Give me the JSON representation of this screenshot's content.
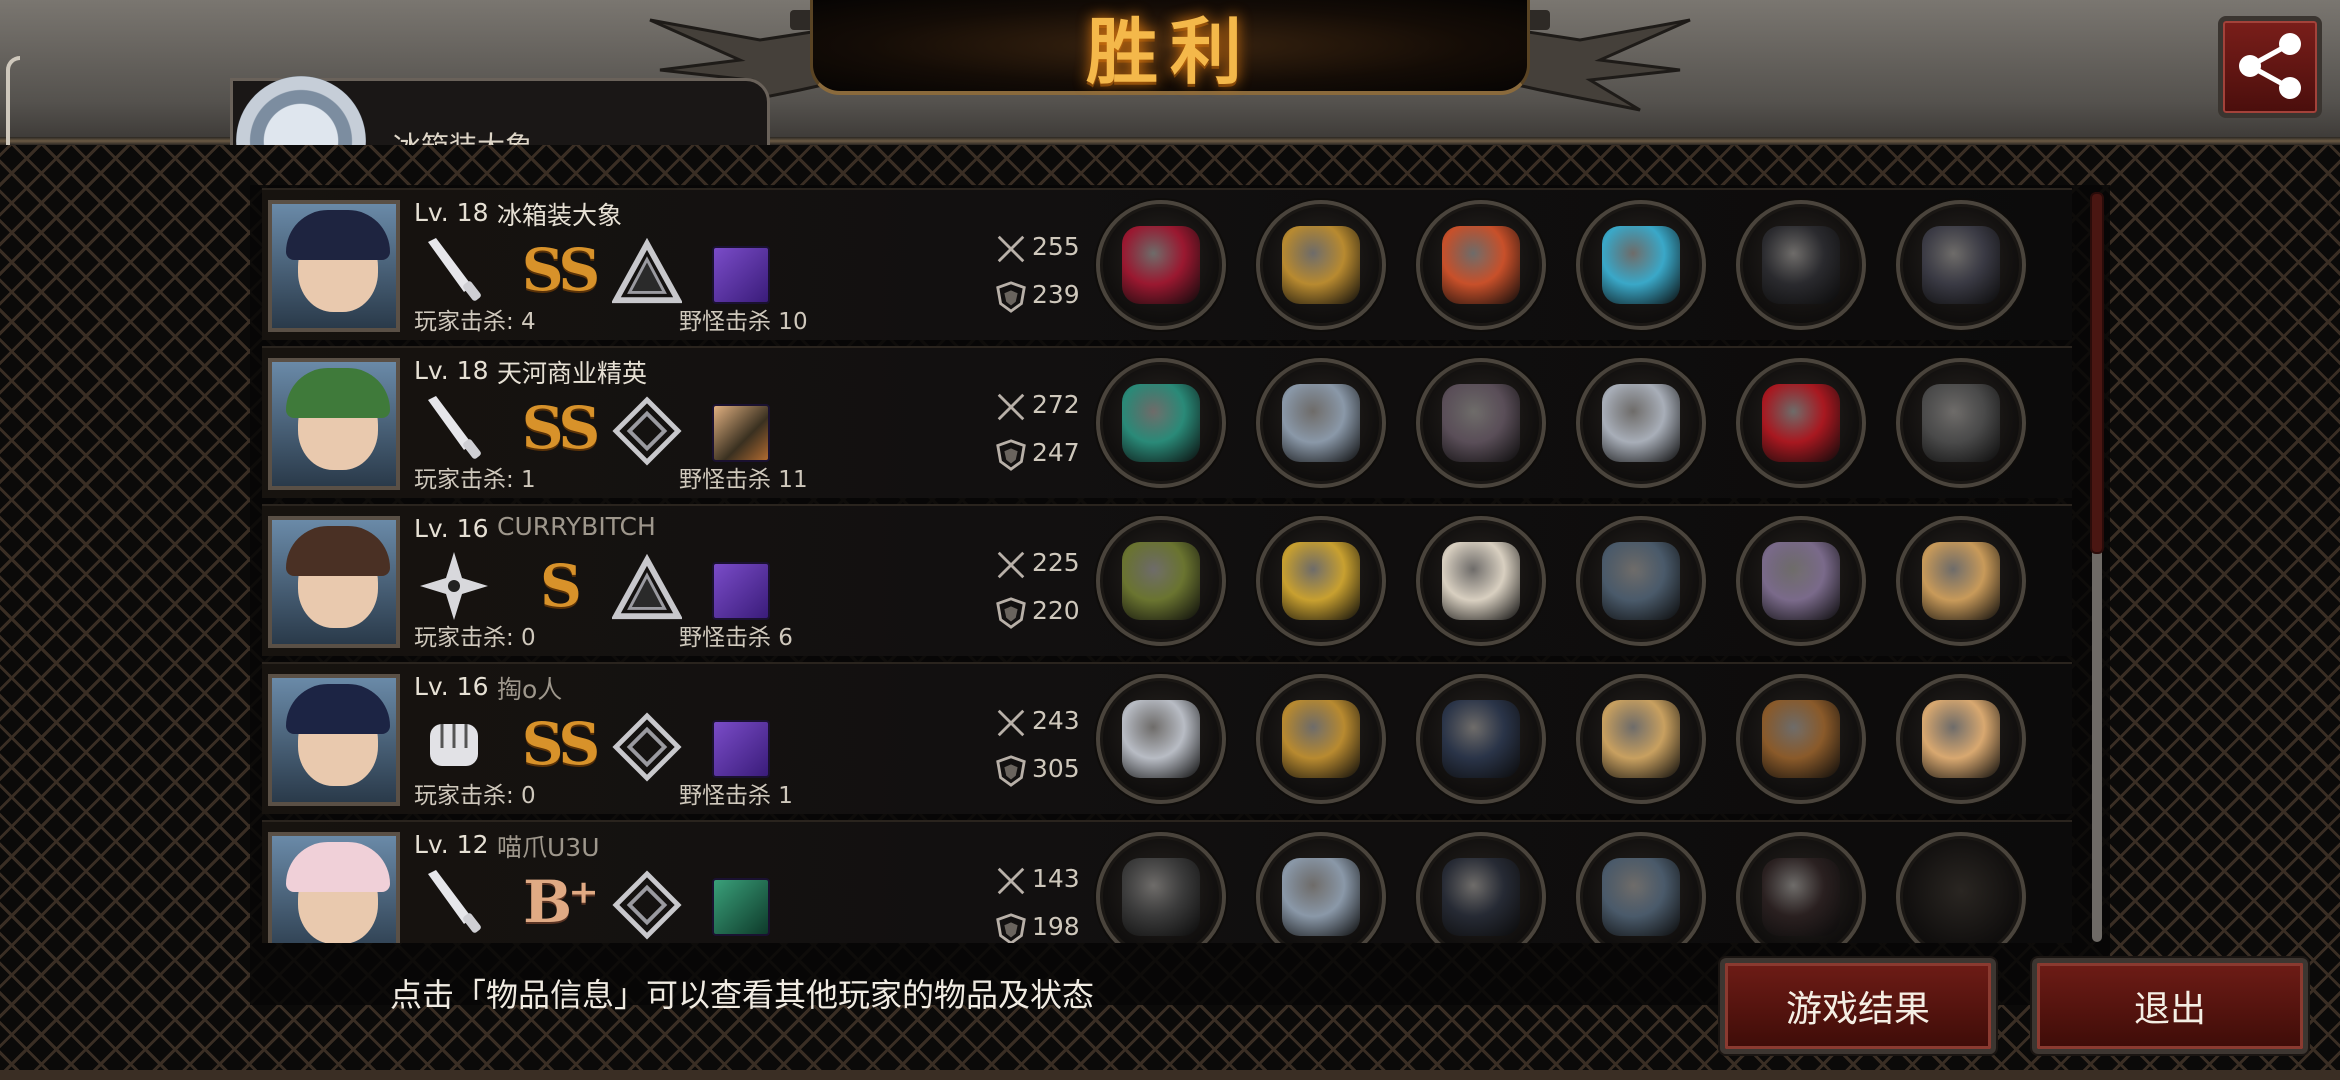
{
  "header": {
    "title": "胜利",
    "player_name": "冰箱装大象",
    "share_icon": "share-icon"
  },
  "players": [
    {
      "level": "Lv. 18",
      "name": "冰箱装大象",
      "rank": "SS",
      "weapon_icon": "knife-icon",
      "tier_icon": "triangle-emblem-icon",
      "player_kills": "玩家击杀: 4",
      "monster_kills": "野怪击杀 10",
      "attack": "255",
      "defense": "239",
      "items": [
        "crimson-sword-icon",
        "gold-helmet-icon",
        "flame-armor-icon",
        "lightning-gauntlet-icon",
        "black-boots-icon",
        "black-flag-icon"
      ]
    },
    {
      "level": "Lv. 18",
      "name": "天河商业精英",
      "rank": "SS",
      "weapon_icon": "knife-icon",
      "tier_icon": "diamond-emblem-icon",
      "player_kills": "玩家击杀: 1",
      "monster_kills": "野怪击杀 11",
      "attack": "272",
      "defense": "247",
      "items": [
        "thorn-wreath-icon",
        "silver-helmet-icon",
        "rock-armor-icon",
        "silver-bracer-icon",
        "red-heels-icon",
        "bag-icon"
      ]
    },
    {
      "level": "Lv. 16",
      "name": "CURRYBITCH",
      "rank": "S",
      "weapon_icon": "shuriken-icon",
      "tier_icon": "triangle-emblem-icon",
      "player_kills": "玩家击杀: 0",
      "monster_kills": "野怪击杀 6",
      "attack": "225",
      "defense": "220",
      "items": [
        "grenade-icon",
        "crown-icon",
        "white-armor-icon",
        "watch-icon",
        "purple-boots-icon",
        "box-icon"
      ]
    },
    {
      "level": "Lv. 16",
      "name": "掏o人",
      "rank": "SS",
      "weapon_icon": "fist-icon",
      "tier_icon": "diamond-emblem-icon",
      "player_kills": "玩家击杀: 0",
      "monster_kills": "野怪击杀 1",
      "attack": "243",
      "defense": "305",
      "items": [
        "gauntlet-icon",
        "gold-helmet-icon",
        "dark-armor-icon",
        "shield-bracer-icon",
        "winged-boots-icon",
        "fan-icon"
      ]
    },
    {
      "level": "Lv. 12",
      "name": "喵爪U3U",
      "rank": "B⁺",
      "weapon_icon": "knife-icon",
      "tier_icon": "diamond-emblem-icon",
      "player_kills": "",
      "monster_kills": "",
      "attack": "143",
      "defense": "198",
      "items": [
        "scythe-icon",
        "silver-helmet-icon",
        "black-coat-icon",
        "watch-icon",
        "floral-boots-icon",
        "empty-slot"
      ]
    }
  ],
  "footer": {
    "hint": "点击「物品信息」可以查看其他玩家的物品及状态",
    "result_button": "游戏结果",
    "exit_button": "退出"
  },
  "colors": {
    "accent_gold": "#f4b84a",
    "button_red": "#6e1c16",
    "rank_gold": "#d8922a"
  }
}
